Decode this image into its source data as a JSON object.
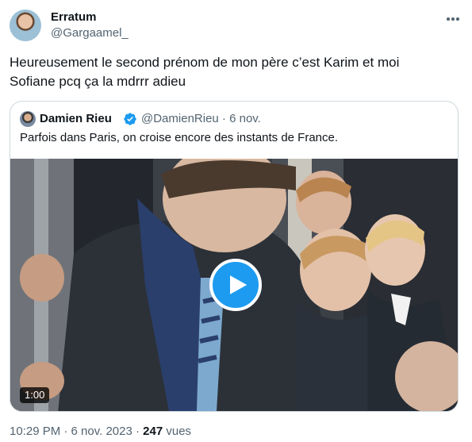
{
  "author": {
    "name": "Erratum",
    "handle": "@Gargaamel_"
  },
  "tweet_text": "Heureusement le second prénom de mon père c’est Karim et moi\nSofiane pcq ça la mdrrr adieu",
  "quoted_tweet": {
    "name": "Damien Rieu",
    "verified": true,
    "handle_date": "@DamienRieu · 6 nov.",
    "text": "Parfois dans Paris, on croise encore des instants de France.",
    "video": {
      "duration": "1:00"
    }
  },
  "meta": {
    "timestamp": "10:29 PM · 6 nov. 2023 · ",
    "views_count": "247",
    "views_label": " vues"
  },
  "icons": {
    "more": "more-horizontal-icon",
    "verified": "verified-badge-icon",
    "play": "play-icon"
  },
  "colors": {
    "accent": "#1d9bf0",
    "text": "#0f1419",
    "secondary": "#536471",
    "border": "#cfd9de"
  }
}
